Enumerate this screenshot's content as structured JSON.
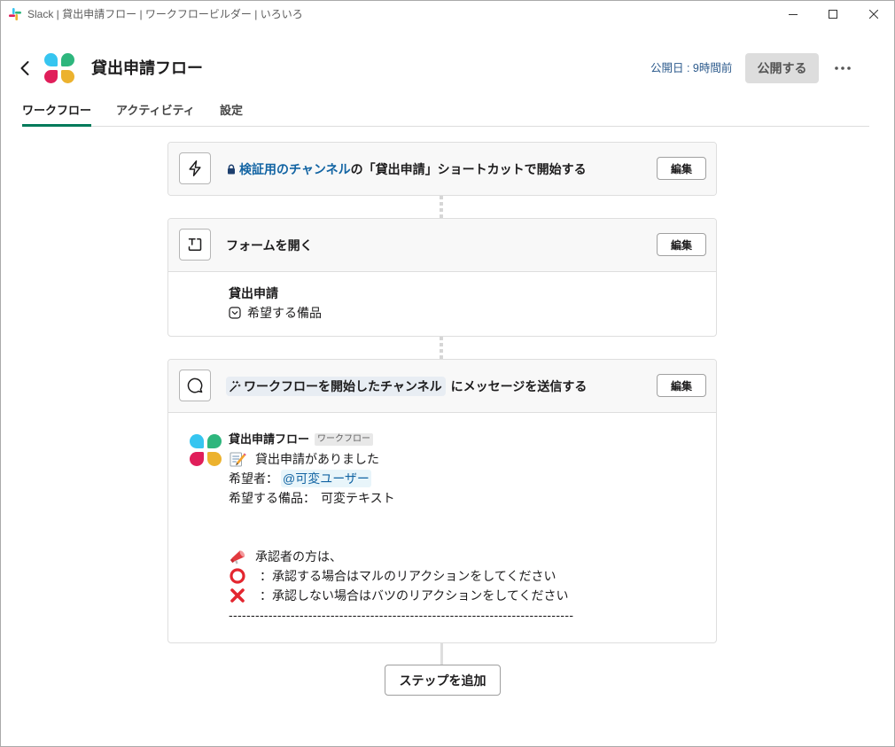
{
  "window": {
    "title": "Slack | 貸出申請フロー | ワークフロービルダー | いろいろ",
    "app_icon": "slack-icon",
    "controls": [
      "minimize-icon",
      "maximize-icon",
      "close-icon"
    ]
  },
  "header": {
    "back_icon": "chevron-left-icon",
    "workflow_icon": "workflow-logo-icon",
    "workflow_name": "貸出申請フロー",
    "published_label": "公開日 : 9時間前",
    "publish_button": "公開する",
    "more_icon": "more-horizontal-icon"
  },
  "tabs": [
    {
      "label": "ワークフロー",
      "active": true
    },
    {
      "label": "アクティビティ",
      "active": false
    },
    {
      "label": "設定",
      "active": false
    }
  ],
  "steps": [
    {
      "icon": "lightning-icon",
      "channel_icon": "lock-icon",
      "channel": "検証用のチャンネル",
      "text": "の「貸出申請」ショートカットで開始する",
      "edit_button": "編集"
    },
    {
      "icon": "form-icon",
      "title": "フォームを開く",
      "edit_button": "編集",
      "form_title": "貸出申請",
      "fields": [
        {
          "icon": "dropdown-icon",
          "label": "希望する備品"
        }
      ]
    },
    {
      "icon": "chat-bubble-icon",
      "channel_icon": "wand-icon",
      "channel": "ワークフローを開始したチャンネル",
      "text": "にメッセージを送信する",
      "edit_button": "編集",
      "message": {
        "avatar": "workflow-logo-icon",
        "sender": "貸出申請フロー",
        "badge": "ワークフロー",
        "heading": {
          "emoji": "memo-icon",
          "text": "貸出申請がありました"
        },
        "requester": {
          "label": "希望者：",
          "mention": "@可変ユーザー"
        },
        "item": {
          "label": "希望する備品：",
          "value": "可変テキスト"
        },
        "approver_note": {
          "emoji": "megaphone-icon",
          "text": "承認者の方は、"
        },
        "approve_rule": {
          "emoji": "red-circle-icon",
          "text": "：承認する場合はマルのリアクションをしてください"
        },
        "reject_rule": {
          "emoji": "cross-mark-icon",
          "text": "：承認しない場合はバツのリアクションをしてください"
        },
        "divider": "------------------------------------------------------------------------------"
      }
    }
  ],
  "add_step_button": "ステップを追加",
  "colors": {
    "accent_green": "#007a5a",
    "link_blue": "#1264a3",
    "published_text": "#2c5a8c",
    "lock_navy": "#1d3f6e",
    "mention_bg": "#e8f5fa",
    "pill_bg": "#e8edf3",
    "publish_bg": "#dddddd",
    "card_head_bg": "#f8f8f8",
    "slack_blue": "#36c5f0",
    "slack_green": "#2eb67d",
    "slack_red": "#e01e5a",
    "slack_yellow": "#ecb22e",
    "emoji_red": "#e3262f"
  }
}
